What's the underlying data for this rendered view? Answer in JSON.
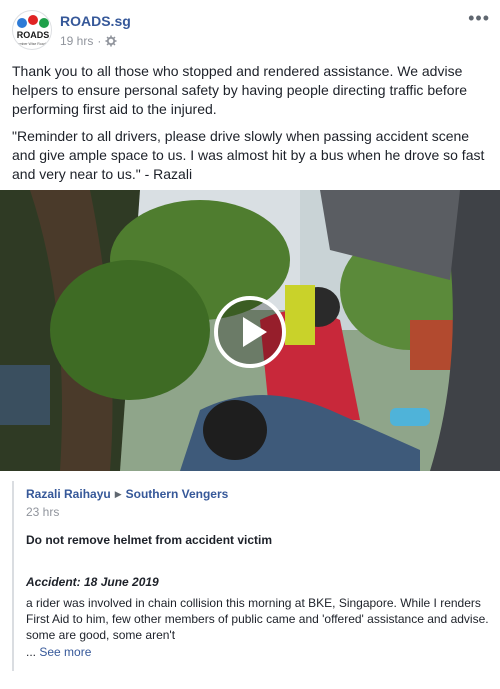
{
  "header": {
    "page_name": "ROADS.sg",
    "timestamp": "19 hrs",
    "separator": "·",
    "more_label": "•••",
    "avatar": {
      "logo_text": "ROADS",
      "tagline": "Remember Wise Road Users"
    }
  },
  "post": {
    "paragraph1": "Thank you to all those who stopped and rendered assistance. We advise helpers to ensure personal safety by having people directing traffic before performing first aid to the injured.",
    "paragraph2": "\"Reminder to all drivers, please drive slowly when passing accident scene and give ample space to us. I was almost hit by a bus when he drove so fast and very near to us.\" - Razali"
  },
  "video": {
    "play_icon": "play-icon"
  },
  "shared": {
    "author": "Razali Raihayu",
    "arrow": "▶",
    "group": "Southern Vengers",
    "time": "23 hrs",
    "title": "Do not remove helmet from accident victim",
    "accident_line": "Accident: 18 June 2019",
    "body": "a rider was involved in chain collision this morning at BKE, Singapore. While I renders First Aid to him, few other members of public came and 'offered' assistance and advise. some are good, some aren't",
    "ellipsis": "...",
    "see_more": "See more"
  },
  "colors": {
    "link": "#365899",
    "meta": "#90949c",
    "text": "#1d2129"
  }
}
